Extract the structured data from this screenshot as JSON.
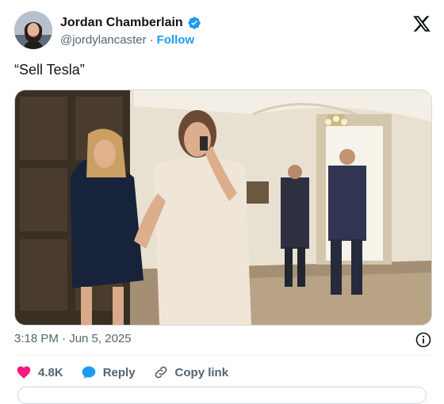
{
  "author": {
    "display_name": "Jordan Chamberlain",
    "handle": "@jordylancaster",
    "separator": "·",
    "follow_label": "Follow",
    "verified_color": "#1d9bf0"
  },
  "tweet": {
    "text": "“Sell Tesla”",
    "image_icon": "photo-of-people-walking-in-hallway"
  },
  "meta": {
    "timestamp": "3:18 PM · Jun 5, 2025"
  },
  "actions": {
    "like_count": "4.8K",
    "reply_label": "Reply",
    "copy_link_label": "Copy link",
    "like_color": "#f91880",
    "reply_color": "#1d9bf0"
  }
}
